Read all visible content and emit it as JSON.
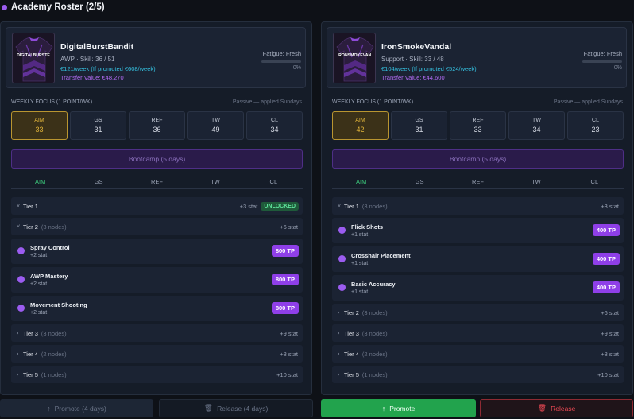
{
  "header": {
    "title": "Academy Roster (2/5)"
  },
  "colors": {
    "accent": "#9b5cf0",
    "focus": "#e2b53a",
    "tab_active": "#3cc57a",
    "tp_button": "#8f3fe8",
    "unlocked": "#5ee29a",
    "promote": "#22a34d",
    "release": "#ef4a55"
  },
  "players": [
    {
      "jersey_text": "DIGITALBURSTE",
      "name": "DigitalBurstBandit",
      "role_skill": "AWP · Skill: 36 / 51",
      "wage": "€121/week (If promoted €608/week)",
      "transfer_value": "Transfer Value: €48,270",
      "fatigue_label": "Fatigue: Fresh",
      "fatigue_pct": "0%",
      "fatigue_fraction": 0,
      "focus_label": "WEEKLY FOCUS (1 POINT/WK)",
      "focus_note": "Passive — applied Sundays",
      "stats": [
        {
          "label": "AIM",
          "value": "33",
          "active": true
        },
        {
          "label": "GS",
          "value": "31",
          "active": false
        },
        {
          "label": "REF",
          "value": "36",
          "active": false
        },
        {
          "label": "TW",
          "value": "49",
          "active": false
        },
        {
          "label": "CL",
          "value": "34",
          "active": false
        }
      ],
      "bootcamp_label": "Bootcamp (5 days)",
      "tabs": [
        "AIM",
        "GS",
        "REF",
        "TW",
        "CL"
      ],
      "active_tab": 0,
      "tree": [
        {
          "kind": "tier",
          "chevron": "˅",
          "name": "Tier 1",
          "nodes": "",
          "stat": "+3 stat",
          "badge": "UNLOCKED"
        },
        {
          "kind": "tier",
          "chevron": "˅",
          "name": "Tier 2",
          "nodes": "(3 nodes)",
          "stat": "+6 stat",
          "badge": ""
        },
        {
          "kind": "node",
          "name": "Spray Control",
          "stat": "+2 stat",
          "cost": "800 TP"
        },
        {
          "kind": "node",
          "name": "AWP Mastery",
          "stat": "+2 stat",
          "cost": "800 TP"
        },
        {
          "kind": "node",
          "name": "Movement Shooting",
          "stat": "+2 stat",
          "cost": "800 TP"
        },
        {
          "kind": "tier",
          "chevron": "›",
          "name": "Tier 3",
          "nodes": "(3 nodes)",
          "stat": "+9 stat",
          "badge": ""
        },
        {
          "kind": "tier",
          "chevron": "›",
          "name": "Tier 4",
          "nodes": "(2 nodes)",
          "stat": "+8 stat",
          "badge": ""
        },
        {
          "kind": "tier",
          "chevron": "›",
          "name": "Tier 5",
          "nodes": "(1 nodes)",
          "stat": "+10 stat",
          "badge": ""
        }
      ],
      "promote_label": "Promote (4 days)",
      "release_label": "Release (4 days)"
    },
    {
      "jersey_text": "IRONSMOKEVAN",
      "name": "IronSmokeVandal",
      "role_skill": "Support · Skill: 33 / 48",
      "wage": "€104/week (If promoted €524/week)",
      "transfer_value": "Transfer Value: €44,600",
      "fatigue_label": "Fatigue: Fresh",
      "fatigue_pct": "0%",
      "fatigue_fraction": 0,
      "focus_label": "WEEKLY FOCUS (1 POINT/WK)",
      "focus_note": "Passive — applied Sundays",
      "stats": [
        {
          "label": "AIM",
          "value": "42",
          "active": true
        },
        {
          "label": "GS",
          "value": "31",
          "active": false
        },
        {
          "label": "REF",
          "value": "33",
          "active": false
        },
        {
          "label": "TW",
          "value": "34",
          "active": false
        },
        {
          "label": "CL",
          "value": "23",
          "active": false
        }
      ],
      "bootcamp_label": "Bootcamp (5 days)",
      "tabs": [
        "AIM",
        "GS",
        "REF",
        "TW",
        "CL"
      ],
      "active_tab": 0,
      "tree": [
        {
          "kind": "tier",
          "chevron": "˅",
          "name": "Tier 1",
          "nodes": "(3 nodes)",
          "stat": "+3 stat",
          "badge": ""
        },
        {
          "kind": "node",
          "name": "Flick Shots",
          "stat": "+1 stat",
          "cost": "400 TP"
        },
        {
          "kind": "node",
          "name": "Crosshair Placement",
          "stat": "+1 stat",
          "cost": "400 TP"
        },
        {
          "kind": "node",
          "name": "Basic Accuracy",
          "stat": "+1 stat",
          "cost": "400 TP"
        },
        {
          "kind": "tier",
          "chevron": "›",
          "name": "Tier 2",
          "nodes": "(3 nodes)",
          "stat": "+6 stat",
          "badge": ""
        },
        {
          "kind": "tier",
          "chevron": "›",
          "name": "Tier 3",
          "nodes": "(3 nodes)",
          "stat": "+9 stat",
          "badge": ""
        },
        {
          "kind": "tier",
          "chevron": "›",
          "name": "Tier 4",
          "nodes": "(2 nodes)",
          "stat": "+8 stat",
          "badge": ""
        },
        {
          "kind": "tier",
          "chevron": "›",
          "name": "Tier 5",
          "nodes": "(1 nodes)",
          "stat": "+10 stat",
          "badge": ""
        }
      ],
      "promote_label": "Promote",
      "release_label": "Release"
    }
  ]
}
